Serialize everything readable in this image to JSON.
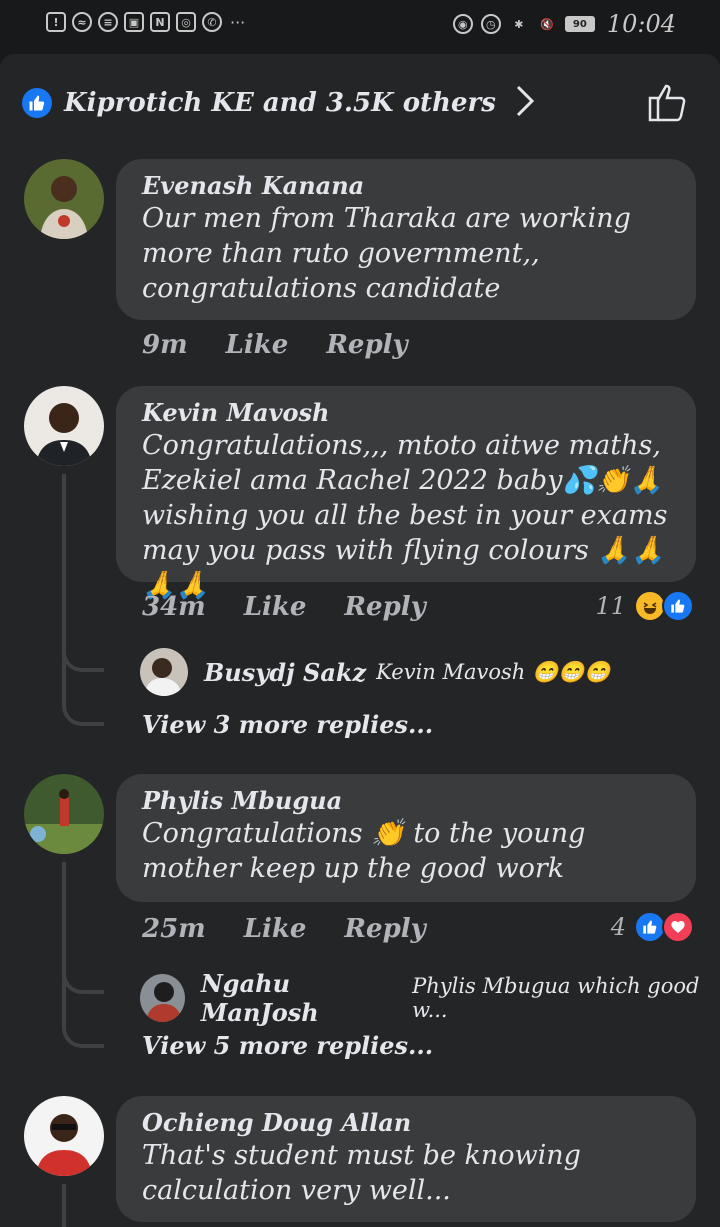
{
  "status_bar": {
    "time": "10:04",
    "battery": "90"
  },
  "header": {
    "reactions_text": "Kiprotich  KE and 3.5K others"
  },
  "comments": [
    {
      "author": "Evenash Kanana",
      "text": "Our men from Tharaka are working more than ruto government,, congratulations candidate",
      "time": "9m",
      "like": "Like",
      "reply": "Reply"
    },
    {
      "author": "Kevin Mavosh",
      "text": "Congratulations,,, mtoto aitwe maths, Ezekiel ama Rachel 2022 baby💦👏🙏 wishing you all the best in your exams may you pass with flying colours 🙏🙏🙏🙏",
      "time": "34m",
      "like": "Like",
      "reply": "Reply",
      "reaction_count": "11",
      "reply_preview": {
        "author": "Busydj Sakz",
        "text": "Kevin Mavosh 😁😁😁"
      },
      "more_replies": "View 3 more replies..."
    },
    {
      "author": "Phylis Mbugua",
      "text": "Congratulations 👏 to the young mother keep up the good work",
      "time": "25m",
      "like": "Like",
      "reply": "Reply",
      "reaction_count": "4",
      "reply_preview": {
        "author": "Ngahu ManJosh",
        "text": "Phylis Mbugua which good w..."
      },
      "more_replies": "View 5 more replies..."
    },
    {
      "author": "Ochieng Doug Allan",
      "text": "That's student must be knowing calculation very well..."
    }
  ]
}
